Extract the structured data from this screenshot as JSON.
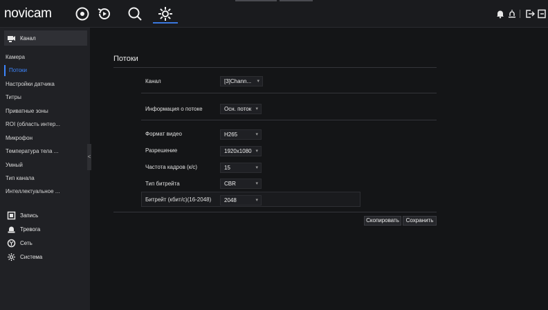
{
  "app": {
    "logo": "novicam"
  },
  "topnav": {
    "items": [
      {
        "icon": "live-view-icon"
      },
      {
        "icon": "playback-icon"
      },
      {
        "icon": "search-icon"
      },
      {
        "icon": "settings-gear-icon",
        "active": true
      }
    ],
    "right_icons": [
      "bell-icon",
      "user-icon",
      "logout-icon",
      "exit-icon"
    ]
  },
  "sidebar": {
    "channel": {
      "label": "Канал",
      "icon": "camera-channel-icon"
    },
    "items": [
      {
        "label": "Камера"
      },
      {
        "label": "Потоки",
        "active": true
      },
      {
        "label": "Настройки датчика"
      },
      {
        "label": "Титры"
      },
      {
        "label": "Приватные зоны"
      },
      {
        "label": "ROI (область интер..."
      },
      {
        "label": "Микрофон"
      },
      {
        "label": "Температура тела ..."
      },
      {
        "label": "Умный"
      },
      {
        "label": "Тип канала"
      },
      {
        "label": "Интеллектуальное ..."
      }
    ],
    "sections": [
      {
        "label": "Запись",
        "icon": "record-icon"
      },
      {
        "label": "Тревога",
        "icon": "alarm-icon"
      },
      {
        "label": "Сеть",
        "icon": "network-icon"
      },
      {
        "label": "Система",
        "icon": "system-icon"
      }
    ],
    "collapse_glyph": "<"
  },
  "page": {
    "title": "Потоки",
    "channel": {
      "label": "Канал",
      "value": "[3]Chann..."
    },
    "stream_info": {
      "label": "Информация о потоке",
      "value": "Осн. поток"
    },
    "video_format": {
      "label": "Формат видео",
      "value": "H265"
    },
    "resolution": {
      "label": "Разрешение",
      "value": "1920x1080"
    },
    "frame_rate": {
      "label": "Частота кадров (к/с)",
      "value": "15"
    },
    "bitrate_type": {
      "label": "Тип битрейта",
      "value": "CBR"
    },
    "bitrate": {
      "label": "Битрейт (кбит/с)(16-2048)",
      "value": "2048"
    },
    "caret": "▾",
    "buttons": {
      "copy": "Скопировать",
      "save": "Сохранить"
    }
  },
  "colors": {
    "accent": "#3d86ff",
    "background": "#141517",
    "sidebar": "#202125"
  }
}
